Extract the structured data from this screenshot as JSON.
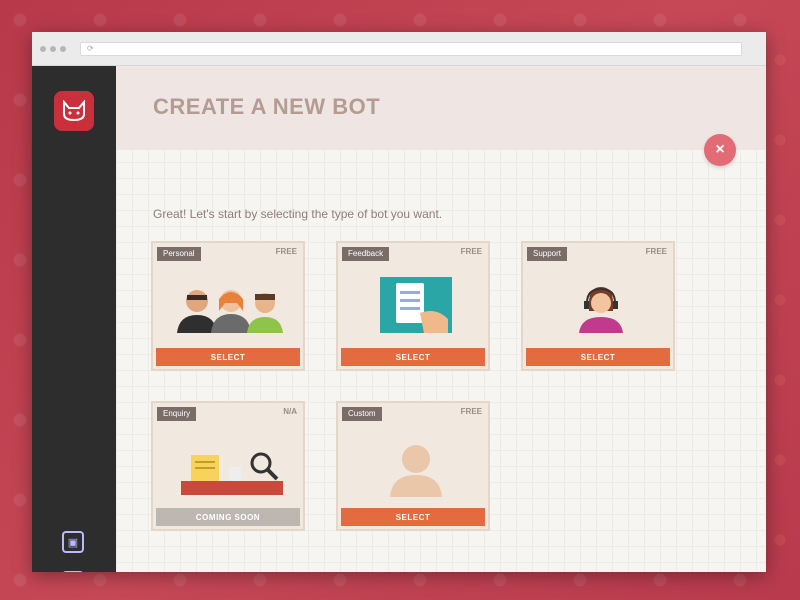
{
  "page": {
    "title": "CREATE A NEW BOT",
    "intro": "Great! Let's start by selecting the type of bot you want.",
    "close_icon": "×"
  },
  "sidebar": {
    "logo_icon": "cat-face",
    "icons": [
      "▣",
      "▢"
    ]
  },
  "cards": [
    {
      "tag": "Personal",
      "badge": "FREE",
      "button": "SELECT",
      "illustration": "group-of-people"
    },
    {
      "tag": "Feedback",
      "badge": "FREE",
      "button": "SELECT",
      "illustration": "tablet-in-hand"
    },
    {
      "tag": "Support",
      "badge": "FREE",
      "button": "SELECT",
      "illustration": "support-agent-headset"
    },
    {
      "tag": "Enquiry",
      "badge": "N/A",
      "button": "COMING SOON",
      "illustration": "magnifying-glass-desk"
    },
    {
      "tag": "Custom",
      "badge": "FREE",
      "button": "SELECT",
      "illustration": "person-silhouette"
    }
  ],
  "colors": {
    "background": "#c0424e",
    "sidebar": "#2d2d2d",
    "accent_button": "#e36b3f",
    "close_button": "#e36b76",
    "title": "#b49c93"
  }
}
